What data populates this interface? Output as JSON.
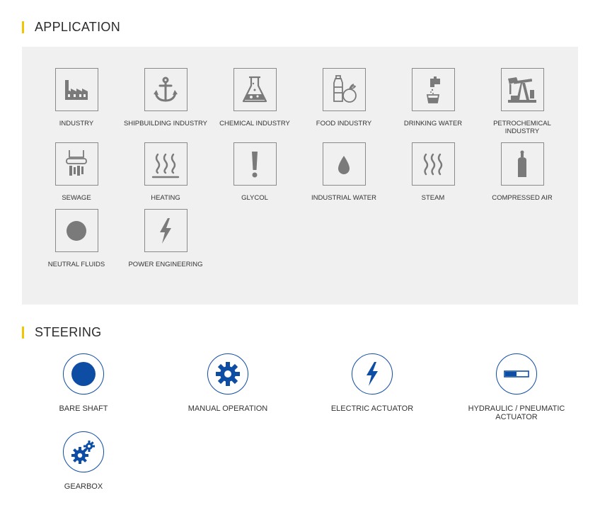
{
  "application": {
    "title": "APPLICATION",
    "items": [
      {
        "label": "INDUSTRY",
        "icon": "factory-icon"
      },
      {
        "label": "SHIPBUILDING INDUSTRY",
        "icon": "anchor-icon"
      },
      {
        "label": "CHEMICAL INDUSTRY",
        "icon": "flask-icon"
      },
      {
        "label": "FOOD INDUSTRY",
        "icon": "food-icon"
      },
      {
        "label": "DRINKING WATER",
        "icon": "tap-icon"
      },
      {
        "label": "PETROCHEMICAL INDUSTRY",
        "icon": "oil-pump-icon"
      },
      {
        "label": "SEWAGE",
        "icon": "sewage-icon"
      },
      {
        "label": "HEATING",
        "icon": "heat-waves-icon"
      },
      {
        "label": "GLYCOL",
        "icon": "exclamation-icon"
      },
      {
        "label": "INDUSTRIAL WATER",
        "icon": "water-drop-icon"
      },
      {
        "label": "STEAM",
        "icon": "steam-icon"
      },
      {
        "label": "COMPRESSED AIR",
        "icon": "gas-cylinder-icon"
      },
      {
        "label": "NEUTRAL FLUIDS",
        "icon": "circle-icon"
      },
      {
        "label": "POWER ENGINEERING",
        "icon": "lightning-icon"
      }
    ]
  },
  "steering": {
    "title": "STEERING",
    "items": [
      {
        "label": "BARE SHAFT",
        "icon": "circle-icon"
      },
      {
        "label": "MANUAL OPERATION",
        "icon": "gear-icon"
      },
      {
        "label": "ELECTRIC ACTUATOR",
        "icon": "lightning-icon"
      },
      {
        "label": "HYDRAULIC / PNEUMATIC ACTUATOR",
        "icon": "piston-icon"
      },
      {
        "label": "GEARBOX",
        "icon": "gears-icon"
      }
    ]
  },
  "colors": {
    "accent": "#f2c500",
    "icon_gray": "#7a7a7a",
    "steering_blue": "#0e4da4",
    "panel_bg": "#f0f0f0"
  }
}
